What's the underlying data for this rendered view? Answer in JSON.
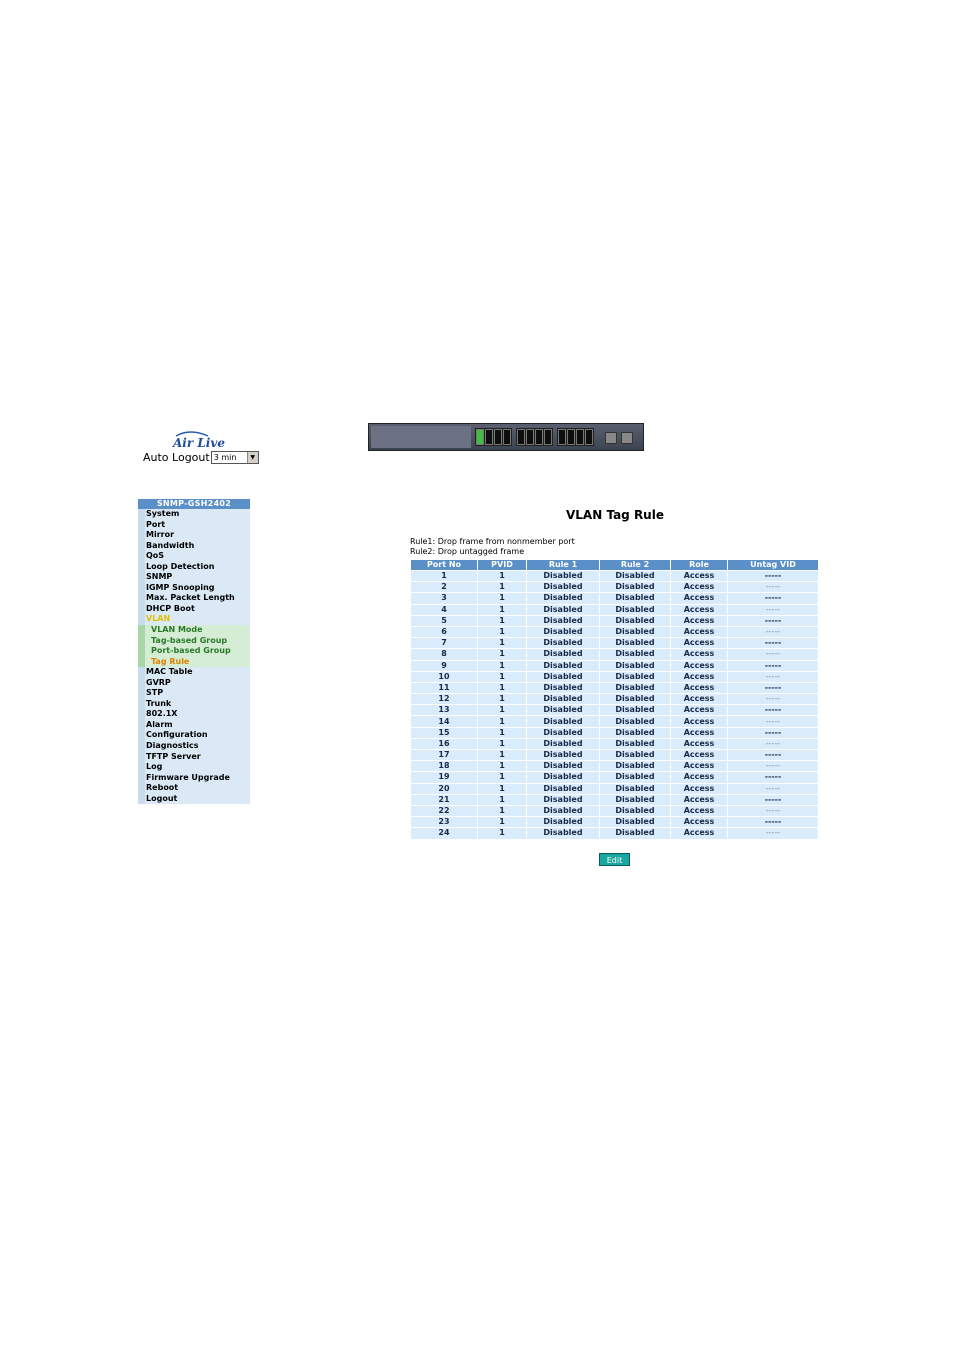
{
  "header": {
    "logo_text": "Air Live",
    "auto_logout_label": "Auto Logout",
    "auto_logout_value": "3 min"
  },
  "menu": {
    "title": "SNMP-GSH2402",
    "items": [
      {
        "label": "System",
        "type": "item"
      },
      {
        "label": "Port",
        "type": "item"
      },
      {
        "label": "Mirror",
        "type": "item"
      },
      {
        "label": "Bandwidth",
        "type": "item"
      },
      {
        "label": "QoS",
        "type": "item"
      },
      {
        "label": "Loop Detection",
        "type": "item"
      },
      {
        "label": "SNMP",
        "type": "item"
      },
      {
        "label": "IGMP Snooping",
        "type": "item"
      },
      {
        "label": "Max. Packet Length",
        "type": "item"
      },
      {
        "label": "DHCP Boot",
        "type": "item"
      },
      {
        "label": "VLAN",
        "type": "active"
      },
      {
        "label": "VLAN Mode",
        "type": "sub"
      },
      {
        "label": "Tag-based Group",
        "type": "sub"
      },
      {
        "label": "Port-based Group",
        "type": "sub"
      },
      {
        "label": "Tag Rule",
        "type": "sub-current"
      },
      {
        "label": "MAC Table",
        "type": "item"
      },
      {
        "label": "GVRP",
        "type": "item"
      },
      {
        "label": "STP",
        "type": "item"
      },
      {
        "label": "Trunk",
        "type": "item"
      },
      {
        "label": "802.1X",
        "type": "item"
      },
      {
        "label": "Alarm",
        "type": "item"
      },
      {
        "label": "Configuration",
        "type": "item"
      },
      {
        "label": "Diagnostics",
        "type": "item"
      },
      {
        "label": "TFTP Server",
        "type": "item"
      },
      {
        "label": "Log",
        "type": "item"
      },
      {
        "label": "Firmware Upgrade",
        "type": "item"
      },
      {
        "label": "Reboot",
        "type": "item"
      },
      {
        "label": "Logout",
        "type": "item"
      }
    ]
  },
  "main": {
    "title": "VLAN Tag Rule",
    "rule1": "Rule1: Drop frame from nonmember port",
    "rule2": "Rule2: Drop untagged frame",
    "columns": [
      "Port No",
      "PVID",
      "Rule 1",
      "Rule 2",
      "Role",
      "Untag VID"
    ],
    "rows": [
      [
        "1",
        "1",
        "Disabled",
        "Disabled",
        "Access",
        "-----"
      ],
      [
        "2",
        "1",
        "Disabled",
        "Disabled",
        "Access",
        "-----"
      ],
      [
        "3",
        "1",
        "Disabled",
        "Disabled",
        "Access",
        "-----"
      ],
      [
        "4",
        "1",
        "Disabled",
        "Disabled",
        "Access",
        "-----"
      ],
      [
        "5",
        "1",
        "Disabled",
        "Disabled",
        "Access",
        "-----"
      ],
      [
        "6",
        "1",
        "Disabled",
        "Disabled",
        "Access",
        "-----"
      ],
      [
        "7",
        "1",
        "Disabled",
        "Disabled",
        "Access",
        "-----"
      ],
      [
        "8",
        "1",
        "Disabled",
        "Disabled",
        "Access",
        "-----"
      ],
      [
        "9",
        "1",
        "Disabled",
        "Disabled",
        "Access",
        "-----"
      ],
      [
        "10",
        "1",
        "Disabled",
        "Disabled",
        "Access",
        "-----"
      ],
      [
        "11",
        "1",
        "Disabled",
        "Disabled",
        "Access",
        "-----"
      ],
      [
        "12",
        "1",
        "Disabled",
        "Disabled",
        "Access",
        "-----"
      ],
      [
        "13",
        "1",
        "Disabled",
        "Disabled",
        "Access",
        "-----"
      ],
      [
        "14",
        "1",
        "Disabled",
        "Disabled",
        "Access",
        "-----"
      ],
      [
        "15",
        "1",
        "Disabled",
        "Disabled",
        "Access",
        "-----"
      ],
      [
        "16",
        "1",
        "Disabled",
        "Disabled",
        "Access",
        "-----"
      ],
      [
        "17",
        "1",
        "Disabled",
        "Disabled",
        "Access",
        "-----"
      ],
      [
        "18",
        "1",
        "Disabled",
        "Disabled",
        "Access",
        "-----"
      ],
      [
        "19",
        "1",
        "Disabled",
        "Disabled",
        "Access",
        "-----"
      ],
      [
        "20",
        "1",
        "Disabled",
        "Disabled",
        "Access",
        "-----"
      ],
      [
        "21",
        "1",
        "Disabled",
        "Disabled",
        "Access",
        "-----"
      ],
      [
        "22",
        "1",
        "Disabled",
        "Disabled",
        "Access",
        "-----"
      ],
      [
        "23",
        "1",
        "Disabled",
        "Disabled",
        "Access",
        "-----"
      ],
      [
        "24",
        "1",
        "Disabled",
        "Disabled",
        "Access",
        "-----"
      ]
    ],
    "edit_label": "Edit"
  },
  "colors": {
    "header_blue": "#5b8fc8",
    "row_bg": "#d8ecfb",
    "menu_active": "#e0c000",
    "menu_current": "#e08000",
    "edit_button": "#1aa7a0"
  },
  "switch_image": {
    "lit_ports": 1,
    "total_ports": 24
  }
}
